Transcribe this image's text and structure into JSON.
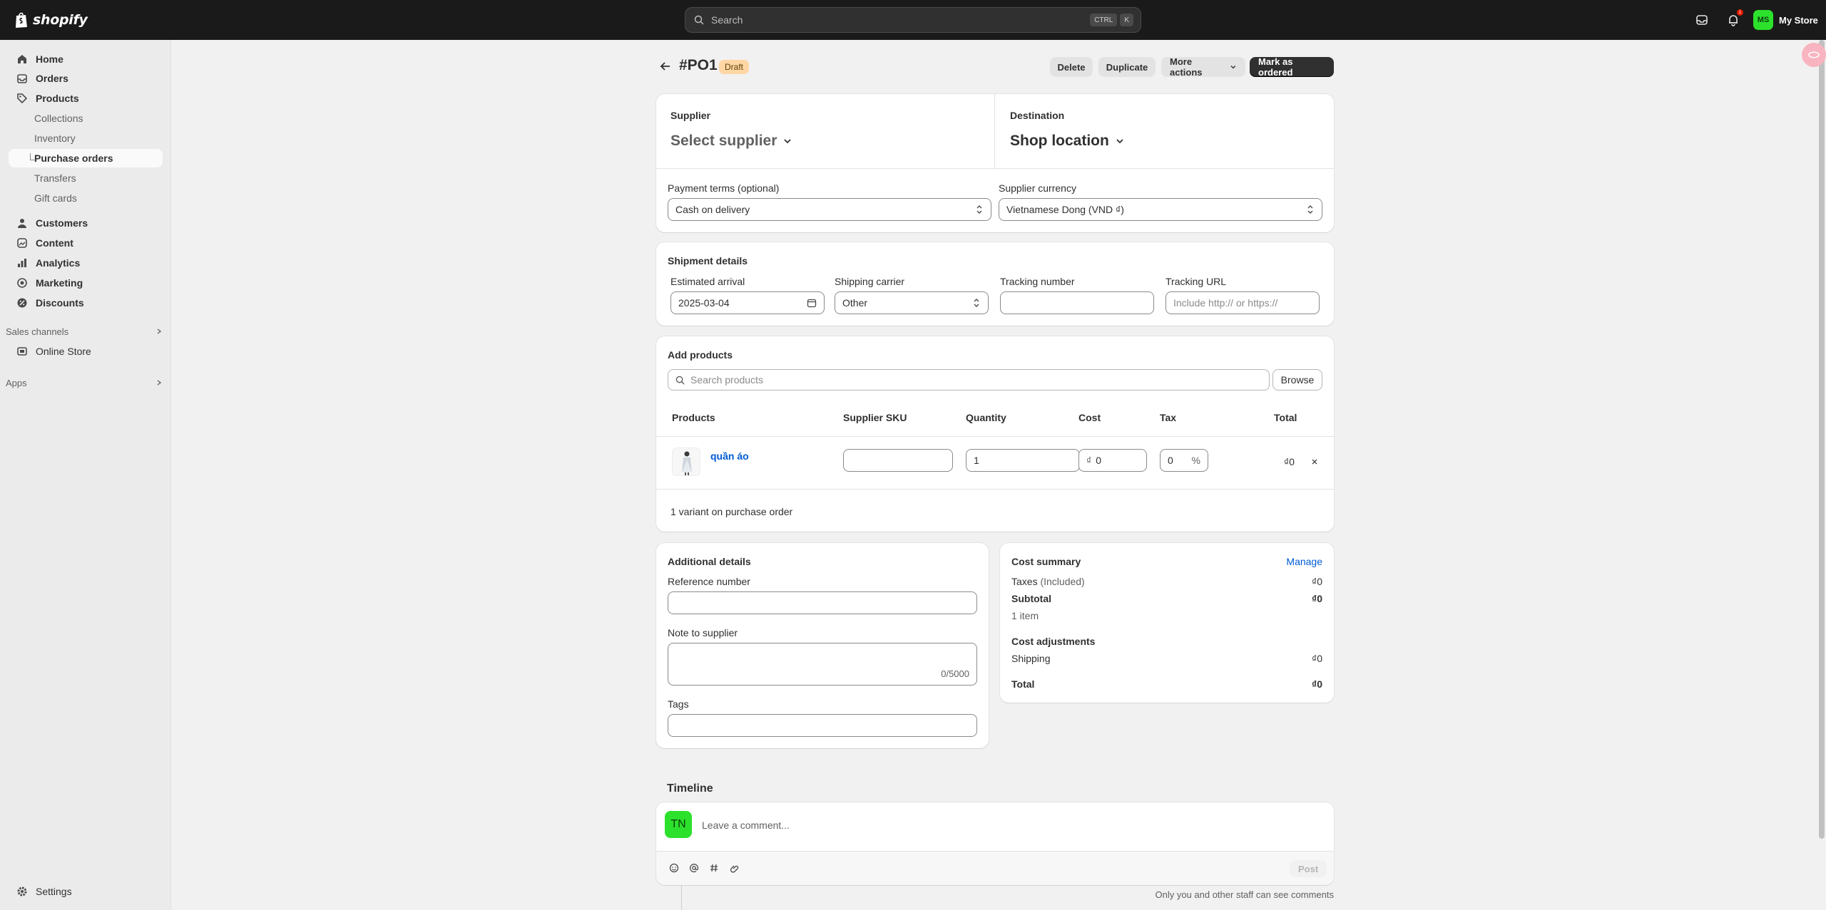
{
  "brand": {
    "logo_text": "shopify",
    "green": "#2ce12c",
    "topbar_bg": "#1a1a1a"
  },
  "topbar": {
    "search_placeholder": "Search",
    "shortcut_keys": [
      "CTRL",
      "K"
    ],
    "notification_count": "1",
    "store_initials": "MS",
    "store_name": "My Store"
  },
  "sidebar": {
    "items": [
      {
        "label": "Home",
        "icon": "home-icon"
      },
      {
        "label": "Orders",
        "icon": "orders-icon"
      },
      {
        "label": "Products",
        "icon": "tag-icon"
      }
    ],
    "product_subitems": [
      "Collections",
      "Inventory",
      "Purchase orders",
      "Transfers",
      "Gift cards"
    ],
    "items2": [
      {
        "label": "Customers",
        "icon": "person-icon"
      },
      {
        "label": "Content",
        "icon": "content-icon"
      },
      {
        "label": "Analytics",
        "icon": "analytics-icon"
      },
      {
        "label": "Marketing",
        "icon": "target-icon"
      },
      {
        "label": "Discounts",
        "icon": "discount-icon"
      }
    ],
    "sales_channels_label": "Sales channels",
    "online_store": "Online Store",
    "apps_label": "Apps",
    "settings": "Settings"
  },
  "page": {
    "title": "#PO1",
    "status": "Draft",
    "actions": {
      "delete": "Delete",
      "duplicate": "Duplicate",
      "more": "More actions",
      "primary": "Mark as ordered"
    }
  },
  "supplier_card": {
    "supplier_label": "Supplier",
    "supplier_value": "Select supplier",
    "destination_label": "Destination",
    "destination_value": "Shop location",
    "payment_label": "Payment terms (optional)",
    "payment_value": "Cash on delivery",
    "currency_label": "Supplier currency",
    "currency_value": "Vietnamese Dong (VND ₫)"
  },
  "shipment": {
    "title": "Shipment details",
    "arrival_label": "Estimated arrival",
    "arrival_value": "2025-03-04",
    "carrier_label": "Shipping carrier",
    "carrier_value": "Other",
    "tracking_label": "Tracking number",
    "tracking_value": "",
    "url_label": "Tracking URL",
    "url_placeholder": "Include http:// or https://"
  },
  "products": {
    "title": "Add products",
    "search_placeholder": "Search products",
    "browse": "Browse",
    "columns": [
      "Products",
      "Supplier SKU",
      "Quantity",
      "Cost",
      "Tax",
      "Total"
    ],
    "rows": [
      {
        "name": "quần áo",
        "sku": "",
        "quantity": "1",
        "cost_prefix": "₫",
        "cost": "0",
        "tax": "0",
        "tax_suffix": "%",
        "total": "₫0"
      }
    ],
    "footer": "1 variant on purchase order"
  },
  "additional": {
    "title": "Additional details",
    "reference_label": "Reference number",
    "note_label": "Note to supplier",
    "note_counter": "0/5000",
    "tags_label": "Tags"
  },
  "cost_summary": {
    "title": "Cost summary",
    "manage": "Manage",
    "taxes_label": "Taxes",
    "taxes_qualifier": "(Included)",
    "taxes_value": "₫0",
    "subtotal_label": "Subtotal",
    "subtotal_value": "₫0",
    "items_count": "1 item",
    "adjustments_label": "Cost adjustments",
    "shipping_label": "Shipping",
    "shipping_value": "₫0",
    "total_label": "Total",
    "total_value": "₫0"
  },
  "timeline": {
    "title": "Timeline",
    "initials": "TN",
    "comment_placeholder": "Leave a comment...",
    "post": "Post",
    "footnote": "Only you and other staff can see comments"
  }
}
